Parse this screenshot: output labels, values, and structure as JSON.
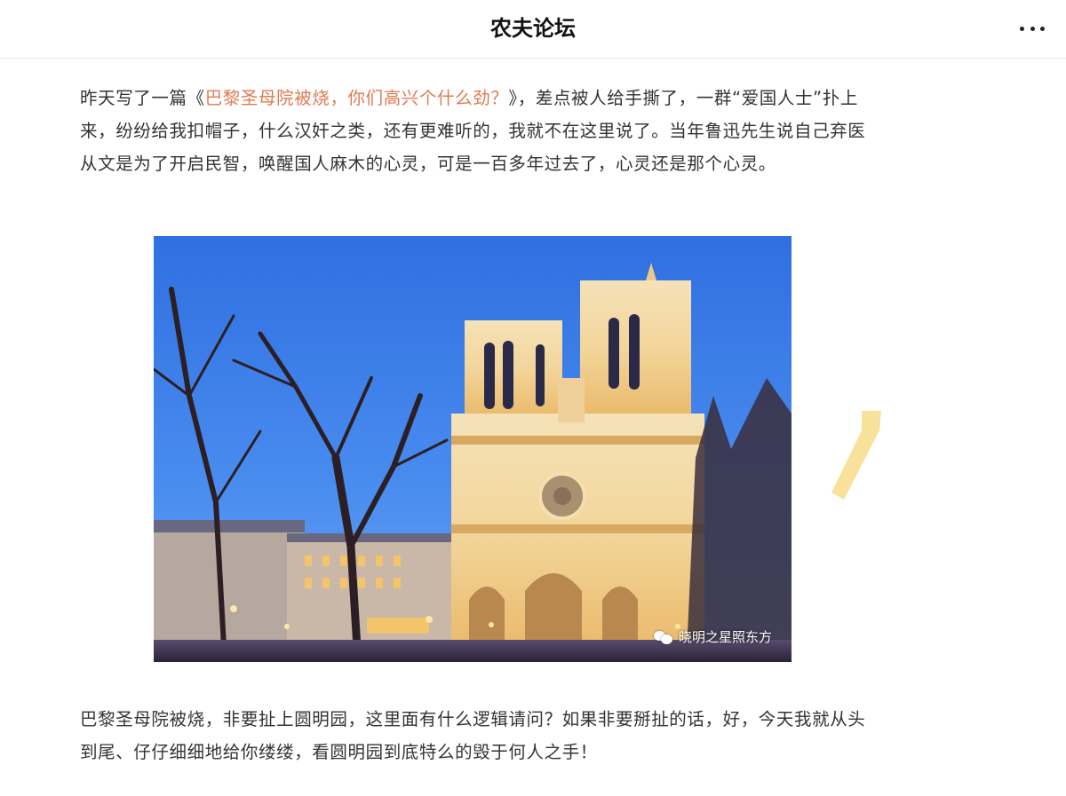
{
  "header": {
    "title": "农夫论坛",
    "more_icon": "more-dots-icon"
  },
  "article": {
    "para1_before": "昨天写了一篇《",
    "para1_link": "巴黎圣母院被烧，你们高兴个什么劲？",
    "para1_after": "》，差点被人给手撕了，一群“爱国人士”扑上来，纷纷给我扣帽子，什么汉奸之类，还有更难听的，我就不在这里说了。当年鲁迅先生说自己弃医从文是为了开启民智，唤醒国人麻木的心灵，可是一百多年过去了，心灵还是那个心灵。",
    "image": {
      "watermark": "晓明之星照东方",
      "watermark_icon": "wechat-icon"
    },
    "para2": "巴黎圣母院被烧，非要扯上圆明园，这里面有什么逻辑请问？如果非要掰扯的话，好，今天我就从头到尾、仔仔细细地给你缕缕，看圆明园到底特么的毁于何人之手！"
  },
  "colors": {
    "link": "#e07a52",
    "text": "#333333",
    "highlight": "#f7dd8a"
  }
}
